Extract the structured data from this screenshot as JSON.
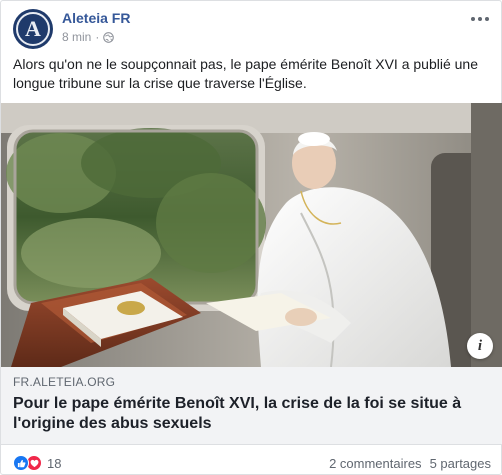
{
  "post": {
    "page_name": "Aleteia FR",
    "avatar_letter": "A",
    "time": "8 min",
    "separator": "·",
    "text": "Alors qu'on ne le soupçonnait pas, le pape émérite Benoît XVI a publié une longue tribune sur la crise que traverse l'Église."
  },
  "link": {
    "domain": "FR.ALETEIA.ORG",
    "headline": "Pour le pape émérite Benoît XVI, la crise de la foi se situe à l'origine des abus sexuels",
    "info_glyph": "i"
  },
  "footer": {
    "reaction_count": "18",
    "comments": "2 commentaires",
    "shares": "5 partages"
  },
  "colors": {
    "page_name": "#365899",
    "like": "#1877f2",
    "love": "#f0284a",
    "link_bg": "#f2f3f5"
  },
  "icons": [
    "globe-icon",
    "more-icon",
    "info-icon",
    "like-icon",
    "love-icon"
  ]
}
